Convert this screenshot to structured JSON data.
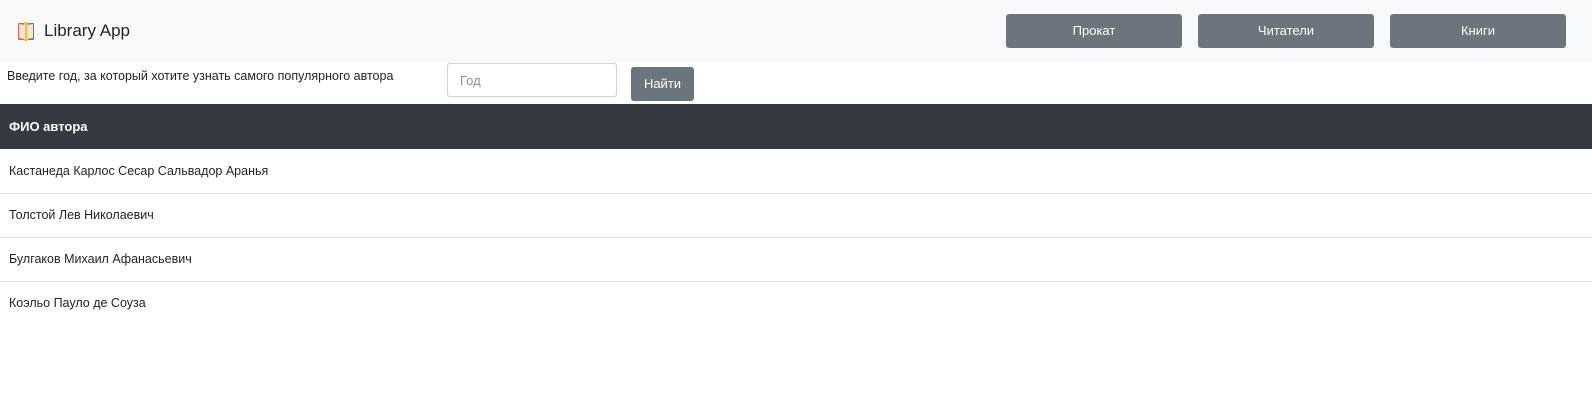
{
  "navbar": {
    "brand": "Library App",
    "brand_icon": "book-icon",
    "buttons": [
      {
        "label": "Прокат"
      },
      {
        "label": "Читатели"
      },
      {
        "label": "Книги"
      }
    ]
  },
  "search": {
    "label": "Введите год, за который хотите узнать самого популярного автора",
    "placeholder": "Год",
    "value": "",
    "button": "Найти"
  },
  "table": {
    "header": "ФИО автора",
    "rows": [
      "Кастанеда Карлос Сесар Сальвадор Аранья",
      "Толстой Лев Николаевич",
      "Булгаков Михаил Афанасьевич",
      "Коэльо Пауло де Соуза"
    ]
  },
  "colors": {
    "navbar_bg": "#f8f9fa",
    "button_bg": "#6c757d",
    "table_header_bg": "#343a40",
    "row_border": "#dee2e6"
  }
}
